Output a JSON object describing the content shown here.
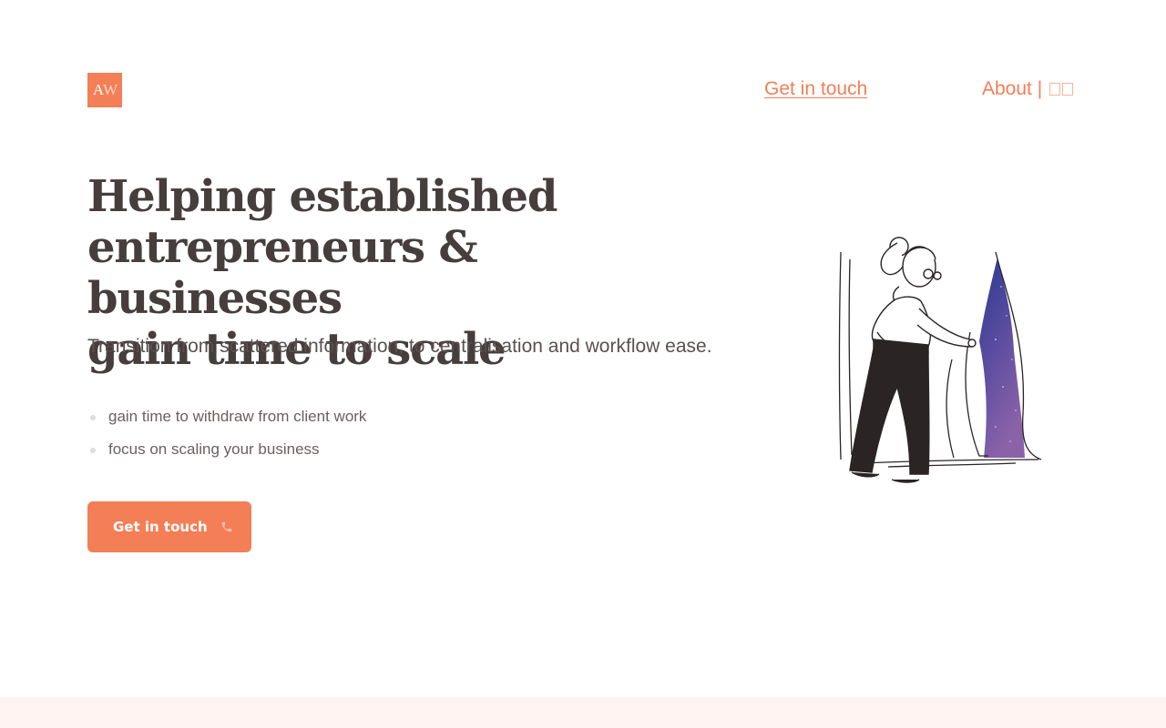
{
  "brand": {
    "logo_a": "A",
    "logo_w": "W"
  },
  "nav": {
    "contact_label": "Get in touch",
    "about_label": "About |"
  },
  "hero": {
    "headline_lines": [
      "Helping established",
      "entrepreneurs & businesses",
      "gain time to scale"
    ],
    "subline": "Transition from scattered information, to centralisation and workflow ease.",
    "bullets": [
      "gain time to withdraw from client work",
      "focus on scaling your business"
    ],
    "cta_label": "Get in touch"
  },
  "icons": {
    "cta": "phone-icon",
    "language": "flag-icon"
  },
  "colors": {
    "accent": "#f47e56",
    "heading": "#463d3d",
    "footer_band": "#fff4f1"
  }
}
